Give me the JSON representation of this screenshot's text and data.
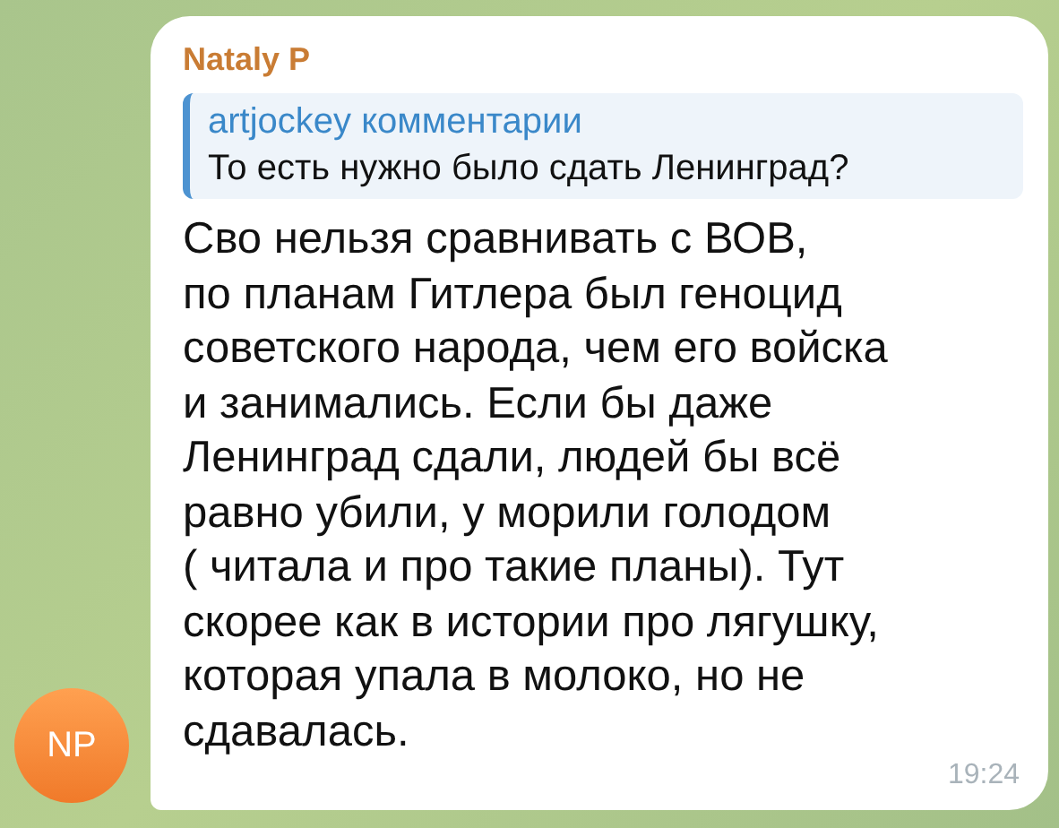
{
  "message": {
    "sender": "Nataly P",
    "avatar_initials": "NP",
    "reply": {
      "author": "artjockey комментарии",
      "text": "То есть нужно было сдать Ленинград?"
    },
    "lines": [
      "Сво нельзя сравнивать с ВОВ,",
      "по планам Гитлера был геноцид",
      "советского народа, чем его войска",
      "и занимались. Если бы даже",
      "Ленинград сдали, людей бы всё",
      "равно убили, у морили голодом",
      "( читала и про такие планы). Тут",
      "скорее как в истории про лягушку,",
      "которая упала в молоко, но не",
      "сдавалась."
    ],
    "time": "19:24"
  }
}
